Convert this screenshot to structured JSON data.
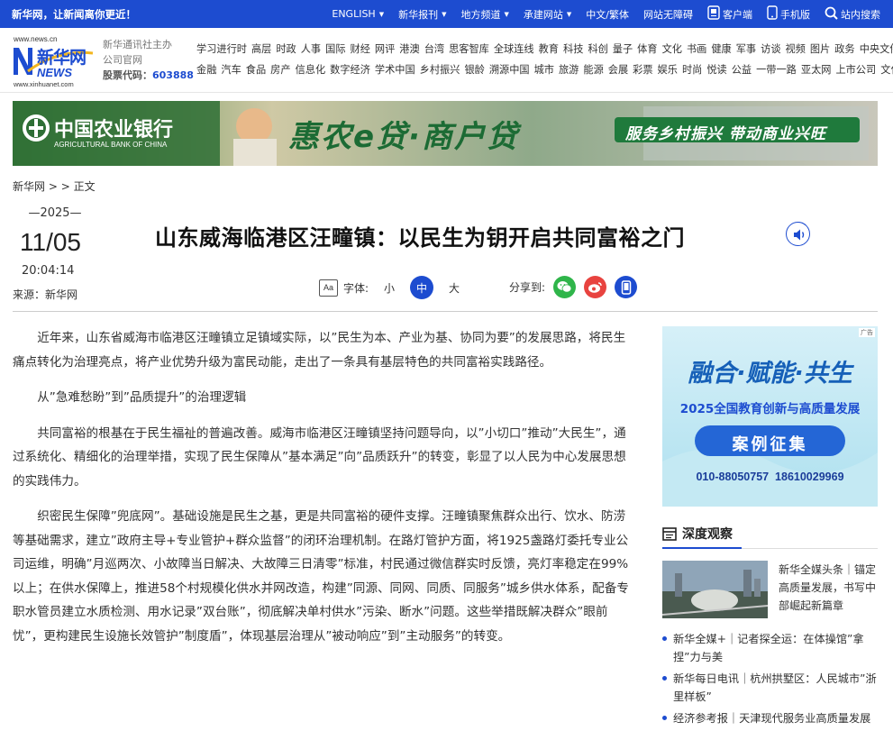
{
  "topbar": {
    "slogan": "新华网，让新闻离你更近！",
    "nav": [
      {
        "label": "ENGLISH",
        "dropdown": true,
        "icon": ""
      },
      {
        "label": "新华报刊",
        "dropdown": true,
        "icon": ""
      },
      {
        "label": "地方频道",
        "dropdown": true,
        "icon": ""
      },
      {
        "label": "承建网站",
        "dropdown": true,
        "icon": ""
      },
      {
        "label": "中文/繁体",
        "dropdown": false,
        "icon": ""
      },
      {
        "label": "网站无障碍",
        "dropdown": false,
        "icon": ""
      },
      {
        "label": "客户端",
        "dropdown": false,
        "icon": "app-icon"
      },
      {
        "label": "手机版",
        "dropdown": false,
        "icon": "phone-icon"
      },
      {
        "label": "站内搜索",
        "dropdown": false,
        "icon": "search-icon"
      }
    ]
  },
  "header": {
    "logo_url_top": "www.news.cn",
    "logo_brand": "新华网",
    "logo_news": "NEWS",
    "logo_url_bottom": "www.xinhuanet.com",
    "org_line1": "新华通讯社主办",
    "org_line2": "公司官网",
    "stock_label": "股票代码：",
    "stock_code": "603888",
    "channels_row1": [
      "学习进行时",
      "高层",
      "时政",
      "人事",
      "国际",
      "财经",
      "网评",
      "港澳",
      "台湾",
      "思客智库",
      "全球连线",
      "教育",
      "科技",
      "科创",
      "量子",
      "体育",
      "文化",
      "书画",
      "健康",
      "军事",
      "访谈",
      "视频",
      "图片",
      "政务",
      "中央文件"
    ],
    "channels_row2": [
      "金融",
      "汽车",
      "食品",
      "房产",
      "信息化",
      "数字经济",
      "学术中国",
      "乡村振兴",
      "银龄",
      "溯源中国",
      "城市",
      "旅游",
      "能源",
      "会展",
      "彩票",
      "娱乐",
      "时尚",
      "悦读",
      "公益",
      "一带一路",
      "亚太网",
      "上市公司",
      "文化产业"
    ]
  },
  "banner": {
    "bank_cn": "中国农业银行",
    "bank_en": "AGRICULTURAL BANK OF CHINA",
    "slogan": "惠农e贷·商户贷",
    "tagline": "服务乡村振兴  带动商业兴旺"
  },
  "breadcrumb": {
    "home": "新华网",
    "sep": ">",
    "current": "正文"
  },
  "article_meta": {
    "year": "2025",
    "month_day": "11/05",
    "time": "20:04:14",
    "source_label": "来源：",
    "source": "新华网"
  },
  "title": "山东威海临港区汪疃镇：以民生为钥开启共同富裕之门",
  "font_control": {
    "label": "字体:",
    "small": "小",
    "medium": "中",
    "large": "大",
    "icon_text": "Aa"
  },
  "share": {
    "label": "分享到:"
  },
  "article": {
    "paragraphs": [
      "近年来，山东省威海市临港区汪疃镇立足镇域实际，以”民生为本、产业为基、协同为要”的发展思路，将民生痛点转化为治理亮点，将产业优势升级为富民动能，走出了一条具有基层特色的共同富裕实践路径。",
      "从”急难愁盼”到”品质提升”的治理逻辑",
      "共同富裕的根基在于民生福祉的普遍改善。威海市临港区汪疃镇坚持问题导向，以”小切口”推动”大民生”，通过系统化、精细化的治理举措，实现了民生保障从”基本满足”向”品质跃升”的转变，彰显了以人民为中心发展思想的实践伟力。",
      "织密民生保障”兜底网”。基础设施是民生之基，更是共同富裕的硬件支撑。汪疃镇聚焦群众出行、饮水、防涝等基础需求，建立”政府主导+专业管护+群众监督”的闭环治理机制。在路灯管护方面，将1925盏路灯委托专业公司运维，明确”月巡两次、小故障当日解决、大故障三日清零”标准，村民通过微信群实时反馈，亮灯率稳定在99%以上；在供水保障上，推进58个村规模化供水并网改造，构建”同源、同网、同质、同服务”城乡供水体系，配备专职水管员建立水质检测、用水记录”双台账”，彻底解决单村供水”污染、断水”问题。这些举措既解决群众”眼前忧”，更构建民生设施长效管护”制度盾”，体现基层治理从”被动响应”到”主动服务”的转变。"
    ]
  },
  "ad": {
    "tag": "广告",
    "headline": "融合·赋能·共生",
    "subtitle": "2025全国教育创新与高质量发展",
    "button": "案例征集",
    "phones": "010-88050757  18610029969"
  },
  "deep_observation": {
    "title": "深度观察",
    "feature_text": "新华全媒头条｜锚定高质量发展，书写中部崛起新篇章",
    "items": [
      "新华全媒+｜记者探全运：在体操馆”拿捏”力与美",
      "新华每日电讯｜杭州拱墅区：人民城市”浙里样板”",
      "经济参考报｜天津现代服务业高质量发展"
    ]
  },
  "colors": {
    "brand_blue": "#1d4cd0",
    "wechat_green": "#2fb54a",
    "weibo_red": "#e8433f",
    "banner_yellow": "#f7e24a"
  }
}
